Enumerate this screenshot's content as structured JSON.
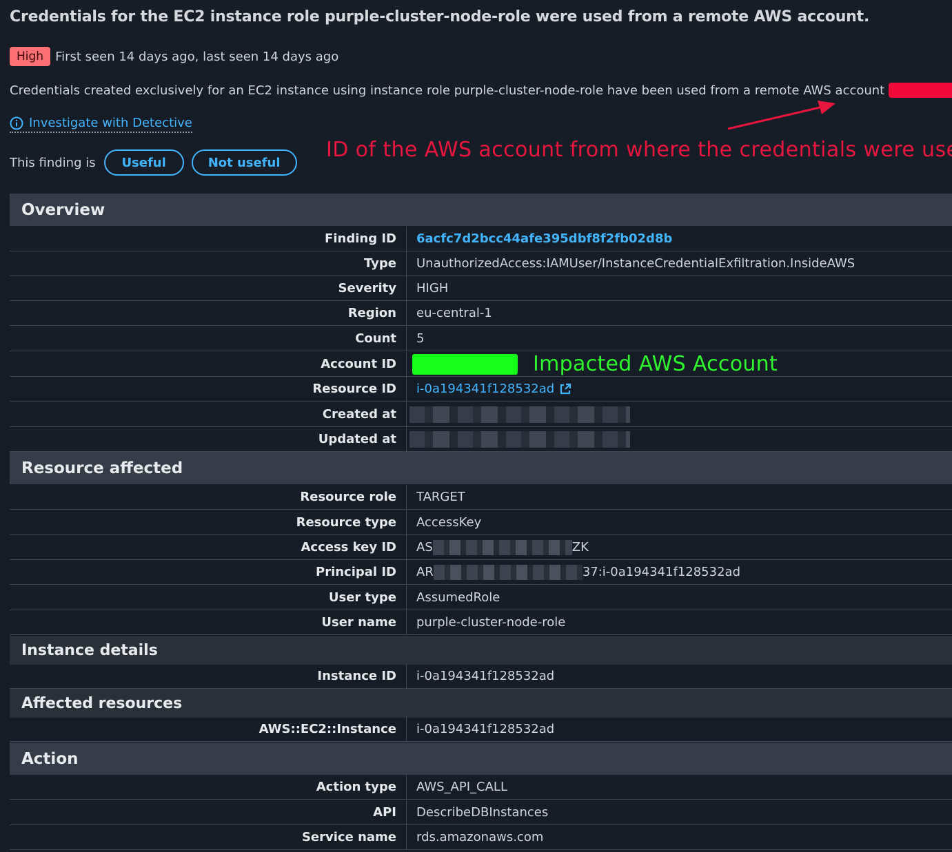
{
  "finding": {
    "title": "Credentials for the EC2 instance role purple-cluster-node-role were used from a remote AWS account.",
    "severity_badge": "High",
    "seen_text": "First seen 14 days ago, last seen 14 days ago",
    "description": "Credentials created exclusively for an EC2 instance using instance role purple-cluster-node-role have been used from a remote AWS account",
    "description_end": ".",
    "investigate_link": "Investigate with Detective",
    "feedback_label": "This finding is",
    "useful_button": "Useful",
    "not_useful_button": "Not useful"
  },
  "annotations": {
    "remote_account": "ID of the AWS account from where the credentials were used",
    "impacted_account": "Impacted AWS Account",
    "remote_color": "#e8163f",
    "impacted_color": "#2ff52f"
  },
  "overview": {
    "heading": "Overview",
    "rows": [
      {
        "key": "Finding ID",
        "value": "6acfc7d2bcc44afe395dbf8f2fb02d8b"
      },
      {
        "key": "Type",
        "value": "UnauthorizedAccess:IAMUser/InstanceCredentialExfiltration.InsideAWS"
      },
      {
        "key": "Severity",
        "value": "HIGH"
      },
      {
        "key": "Region",
        "value": "eu-central-1"
      },
      {
        "key": "Count",
        "value": "5"
      },
      {
        "key": "Account ID",
        "value": ""
      },
      {
        "key": "Resource ID",
        "value": "i-0a194341f128532ad"
      },
      {
        "key": "Created at",
        "value": ""
      },
      {
        "key": "Updated at",
        "value": ""
      }
    ]
  },
  "resource_affected": {
    "heading": "Resource affected",
    "rows": [
      {
        "key": "Resource role",
        "value": "TARGET"
      },
      {
        "key": "Resource type",
        "value": "AccessKey"
      },
      {
        "key": "Access key ID",
        "value_prefix": "AS",
        "value_suffix": "ZK"
      },
      {
        "key": "Principal ID",
        "value_prefix": "AR",
        "value_suffix": "37:i-0a194341f128532ad"
      },
      {
        "key": "User type",
        "value": "AssumedRole"
      },
      {
        "key": "User name",
        "value": "purple-cluster-node-role"
      }
    ]
  },
  "instance_details": {
    "heading": "Instance details",
    "rows": [
      {
        "key": "Instance ID",
        "value": "i-0a194341f128532ad"
      }
    ]
  },
  "affected_resources": {
    "heading": "Affected resources",
    "rows": [
      {
        "key": "AWS::EC2::Instance",
        "value": "i-0a194341f128532ad"
      }
    ]
  },
  "action": {
    "heading": "Action",
    "rows": [
      {
        "key": "Action type",
        "value": "AWS_API_CALL"
      },
      {
        "key": "API",
        "value": "DescribeDBInstances"
      },
      {
        "key": "Service name",
        "value": "rds.amazonaws.com"
      }
    ]
  },
  "colors": {
    "background": "#161d26",
    "link": "#42b4ff",
    "severity_high": "#ff7074",
    "section_header": "#353c48"
  }
}
